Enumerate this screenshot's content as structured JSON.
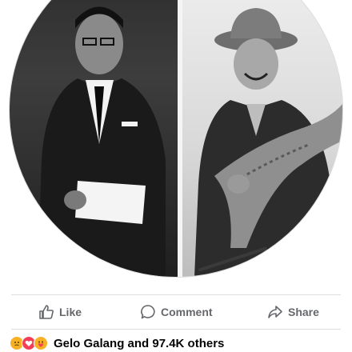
{
  "actions": {
    "like_label": "Like",
    "comment_label": "Comment",
    "share_label": "Share"
  },
  "icons": {
    "like": "thumbs-up-icon",
    "comment": "speech-bubble-icon",
    "share": "share-arrow-icon",
    "reaction_sad": "sad-reaction-icon",
    "reaction_love": "love-reaction-icon",
    "reaction_care": "care-reaction-icon"
  },
  "reactions": {
    "summary": "Gelo Galang and 97.4K others"
  },
  "colors": {
    "action_text": "#65676b",
    "summary_text": "#050505",
    "love": "#f33e58",
    "sad": "#f7b125"
  }
}
